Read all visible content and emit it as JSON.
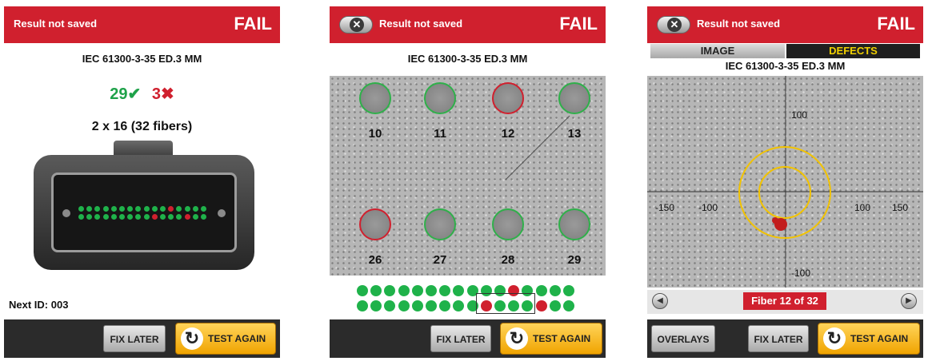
{
  "colors": {
    "header_red": "#d0202e",
    "pass_green": "#1fb24a",
    "fail_red": "#d0202e",
    "button_yellow": "#f5b81c"
  },
  "screen1": {
    "header_status": "Result not saved",
    "header_result": "FAIL",
    "standard": "IEC 61300-3-35 ED.3 MM",
    "pass_count": "29",
    "pass_icon": "✔",
    "fail_count": "3",
    "fail_icon": "✖",
    "fiber_config": "2 x 16 (32 fibers)",
    "next_id": "Next ID: 003",
    "fix_later": "FIX LATER",
    "test_again": "TEST AGAIN",
    "top_row": [
      "pass",
      "pass",
      "pass",
      "pass",
      "pass",
      "pass",
      "pass",
      "pass",
      "pass",
      "pass",
      "pass",
      "fail",
      "pass",
      "pass",
      "pass",
      "pass"
    ],
    "bottom_row": [
      "pass",
      "pass",
      "pass",
      "pass",
      "pass",
      "pass",
      "pass",
      "pass",
      "pass",
      "fail",
      "pass",
      "pass",
      "pass",
      "fail",
      "pass",
      "pass"
    ]
  },
  "screen2": {
    "header_status": "Result not saved",
    "header_result": "FAIL",
    "close_icon": "close-icon",
    "standard": "IEC 61300-3-35 ED.3 MM",
    "fibers": [
      {
        "label": "10",
        "status": "pass"
      },
      {
        "label": "11",
        "status": "pass"
      },
      {
        "label": "12",
        "status": "fail"
      },
      {
        "label": "13",
        "status": "pass"
      },
      {
        "label": "26",
        "status": "fail"
      },
      {
        "label": "27",
        "status": "pass"
      },
      {
        "label": "28",
        "status": "pass"
      },
      {
        "label": "29",
        "status": "pass"
      }
    ],
    "top_row": [
      "pass",
      "pass",
      "pass",
      "pass",
      "pass",
      "pass",
      "pass",
      "pass",
      "pass",
      "pass",
      "pass",
      "fail",
      "pass",
      "pass",
      "pass",
      "pass"
    ],
    "bottom_row": [
      "pass",
      "pass",
      "pass",
      "pass",
      "pass",
      "pass",
      "pass",
      "pass",
      "pass",
      "fail",
      "pass",
      "pass",
      "pass",
      "fail",
      "pass",
      "pass"
    ],
    "fix_later": "FIX LATER",
    "test_again": "TEST AGAIN"
  },
  "screen3": {
    "header_status": "Result not saved",
    "header_result": "FAIL",
    "tab_image": "IMAGE",
    "tab_defects": "DEFECTS",
    "standard": "IEC 61300-3-35 ED.3 MM",
    "axis_labels": {
      "top": "100",
      "bottom": "-100",
      "left_outer": "-150",
      "left_inner": "-100",
      "right_inner": "100",
      "right_outer": "150"
    },
    "fiber_indicator": "Fiber 12 of 32",
    "overlays": "OVERLAYS",
    "fix_later": "FIX LATER",
    "test_again": "TEST AGAIN"
  }
}
